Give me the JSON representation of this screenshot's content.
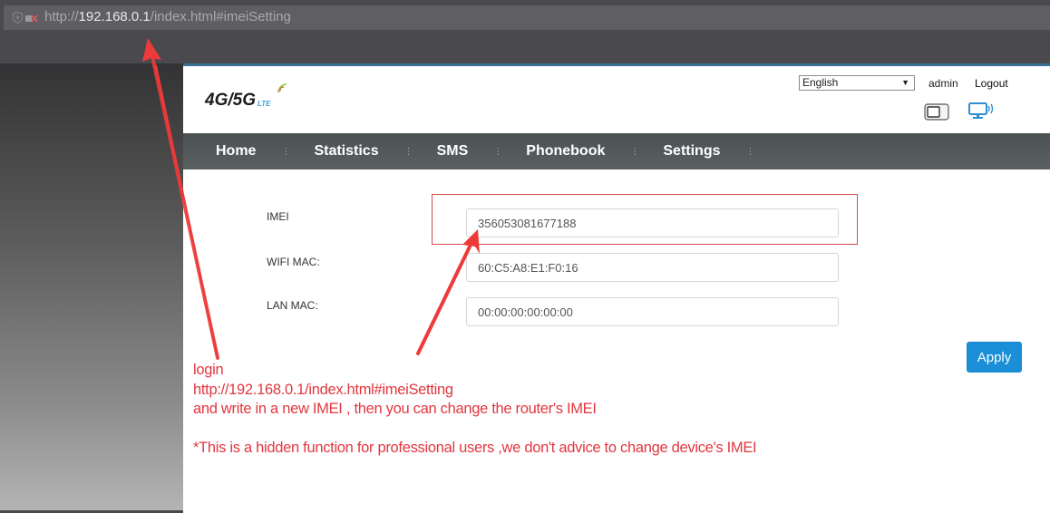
{
  "browser": {
    "url_prefix": "http://",
    "url_host": "192.168.0.1",
    "url_path": "/index.html#imeiSetting"
  },
  "header": {
    "logo_main": "4G/5G",
    "logo_sub": "LTE",
    "language": "English",
    "user": "admin",
    "logout_label": "Logout"
  },
  "nav": {
    "items": [
      {
        "label": "Home"
      },
      {
        "label": "Statistics"
      },
      {
        "label": "SMS"
      },
      {
        "label": "Phonebook"
      },
      {
        "label": "Settings"
      }
    ],
    "separator": "⋮"
  },
  "form": {
    "imei_label": "IMEI",
    "imei_value": "356053081677188",
    "wifi_mac_label": "WIFI MAC:",
    "wifi_mac_value": "60:C5:A8:E1:F0:16",
    "lan_mac_label": "LAN MAC:",
    "lan_mac_value": "00:00:00:00:00:00",
    "apply_label": "Apply"
  },
  "annotation": {
    "line1": "login",
    "line2": "http://192.168.0.1/index.html#imeiSetting",
    "line3": "and write in a new IMEI , then you can change the router's IMEI",
    "note": "*This is a hidden function for professional users ,we don't advice to change device's IMEI",
    "color": "#e2373f"
  }
}
